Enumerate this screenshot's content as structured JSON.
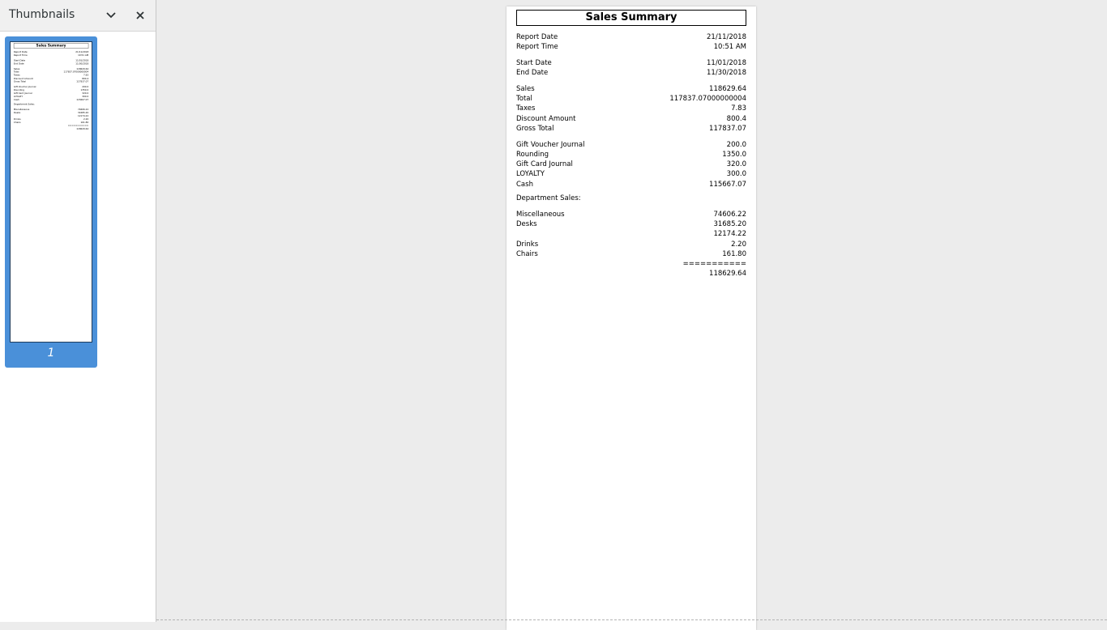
{
  "sidebar": {
    "title": "Thumbnails",
    "page_number": "1",
    "dropdown_icon": "chevron-down-icon",
    "close_icon": "close-icon"
  },
  "report": {
    "title": "Sales Summary",
    "report_date_label": "Report Date",
    "report_date_value": "21/11/2018",
    "report_time_label": "Report Time",
    "report_time_value": "10:51 AM",
    "start_date_label": "Start Date",
    "start_date_value": "11/01/2018",
    "end_date_label": "End Date",
    "end_date_value": "11/30/2018",
    "sales_label": "Sales",
    "sales_value": "118629.64",
    "total_label": "Total",
    "total_value": "117837.07000000004",
    "taxes_label": "Taxes",
    "taxes_value": "7.83",
    "discount_label": "Discount Amount",
    "discount_value": "800.4",
    "gross_label": "Gross Total",
    "gross_value": "117837.07",
    "gift_voucher_label": "Gift Voucher Journal",
    "gift_voucher_value": "200.0",
    "rounding_label": "Rounding",
    "rounding_value": "1350.0",
    "gift_card_label": "Gift Card Journal",
    "gift_card_value": "320.0",
    "loyalty_label": "LOYALTY",
    "loyalty_value": "300.0",
    "cash_label": "Cash",
    "cash_value": "115667.07",
    "dept_heading": "Department Sales:",
    "misc_label": "Miscellaneous",
    "misc_value": "74606.22",
    "desks_label": "Desks",
    "desks_value": "31685.20",
    "unnamed_label": "",
    "unnamed_value": "12174.22",
    "drinks_label": "Drinks",
    "drinks_value": "2.20",
    "chairs_label": "Chairs",
    "chairs_value": "161.80",
    "separator": "===========",
    "dept_total": "118629.64"
  },
  "colors": {
    "selection": "#4a90d9",
    "background": "#ececec"
  }
}
